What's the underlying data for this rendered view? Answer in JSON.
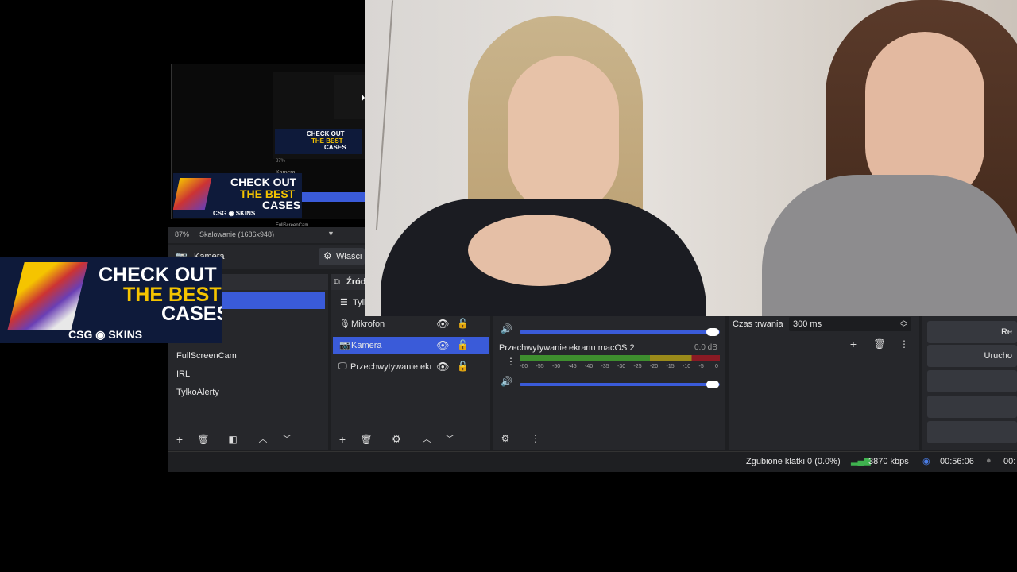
{
  "preview": {
    "nested_source": "Kamera",
    "nested_zoom": "87%",
    "nested_scene": "FullScreenCam",
    "zoom": "87%",
    "scaling": "Skalowanie (1686x948)"
  },
  "context_bar": {
    "source_name": "Kamera",
    "properties_label": "Właści"
  },
  "ad": {
    "line1": "CHECK OUT",
    "line2": "THE BEST",
    "line3": "CASES",
    "brand_a": "CSG",
    "brand_b": "SKINS"
  },
  "scenes": {
    "items": [
      "FullScreenCam",
      "IRL",
      "TylkoAlerty"
    ]
  },
  "sources": {
    "header": "Źród",
    "partial_item": "Tylk",
    "items": [
      {
        "label": "Mikrofon",
        "icon": "microphone-icon"
      },
      {
        "label": "Kamera",
        "icon": "camera-icon"
      },
      {
        "label": "Przechwytywanie ekr",
        "icon": "monitor-icon"
      }
    ]
  },
  "mixer": {
    "channel_name": "Przechwytywanie ekranu macOS 2",
    "channel_db": "0.0 dB",
    "ticks": [
      "-60",
      "-55",
      "-50",
      "-45",
      "-40",
      "-35",
      "-30",
      "-25",
      "-20",
      "-15",
      "-10",
      "-5",
      "0"
    ],
    "volume_level": 1.0
  },
  "transitions": {
    "duration_label": "Czas trwania",
    "duration_value": "300 ms"
  },
  "controls": {
    "btn1": "Re",
    "btn2": "Urucho"
  },
  "status": {
    "dropped": "Zgubione klatki 0 (0.0%)",
    "bitrate": "3870 kbps",
    "stream_time": "00:56:06",
    "rec_time": "00:"
  }
}
